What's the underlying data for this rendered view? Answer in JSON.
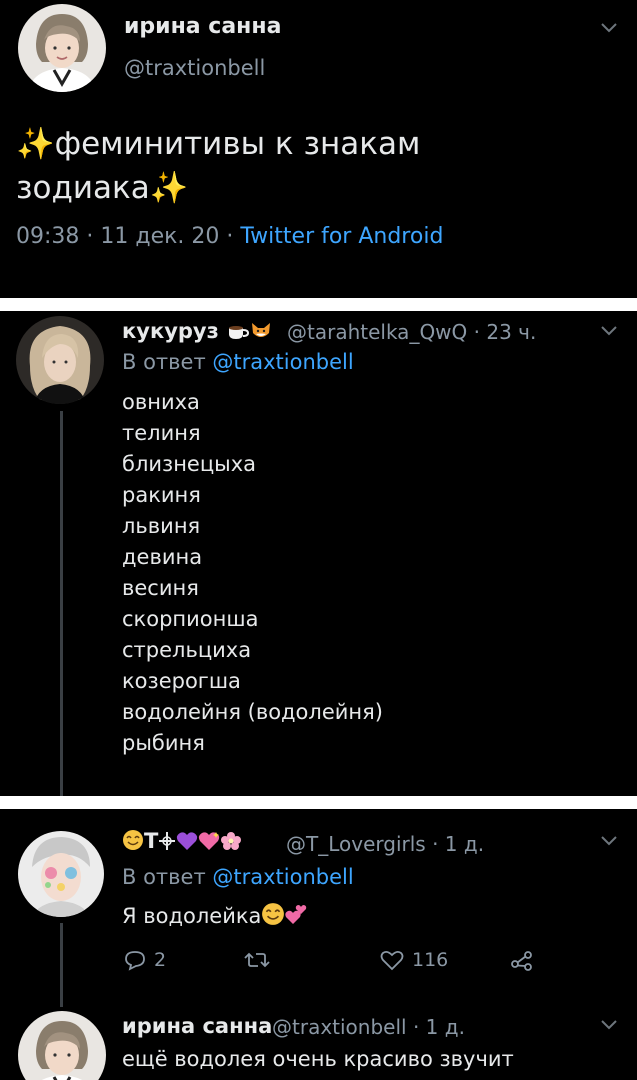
{
  "tweet1": {
    "name": "ирина санна",
    "handle": "@traxtionbell",
    "text": "✨феминитивы к знакам зодиака✨",
    "time": "09:38 · 11 дек. 20 · ",
    "source": "Twitter for Android"
  },
  "reply1": {
    "name": "кукуруз",
    "handle": "@tarahtelka_QwQ · 23 ч.",
    "reply_prefix": "В ответ",
    "reply_handle": "@traxtionbell",
    "items": [
      "овниха",
      "телиня",
      "близнецыха",
      "ракиня",
      "львиня",
      "девина",
      "весиня",
      "скорпионша",
      "стрельциха",
      "козерогша",
      "водолейня (водолейня)",
      "рыбиня"
    ]
  },
  "reply2": {
    "name_text": "T",
    "handle": "@T_Lovergirls · 1 д.",
    "reply_prefix": "В ответ",
    "reply_handle": "@traxtionbell",
    "text": "Я водолейка",
    "reply_count": "2",
    "retweet_count": "",
    "like_count": "116"
  },
  "reply3": {
    "name": "ирина санна",
    "handle": "@traxtionbell · 1 д.",
    "text": "ещё водолея очень красиво звучит"
  },
  "icons": {
    "more": "chevron-down-icon",
    "reply": "comment-icon",
    "retweet": "retweet-icon",
    "like": "heart-icon",
    "share": "share-icon"
  },
  "colors": {
    "background": "#000000",
    "text": "#e7e9ea",
    "muted": "#8b98a5",
    "link": "#3ea6ff",
    "separator": "#ffffff"
  }
}
